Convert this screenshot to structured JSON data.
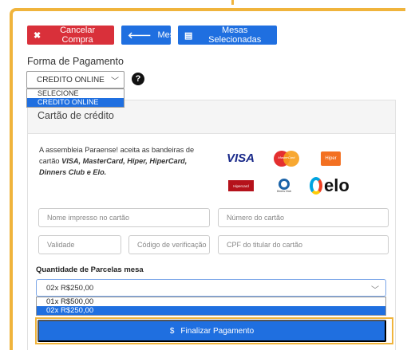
{
  "toolbar": {
    "cancel_label": "Cancelar Compra",
    "mesas_label": "Mesas",
    "selected_label": "Mesas Selecionadas"
  },
  "payment": {
    "label": "Forma de Pagamento",
    "selected": "CREDITO ONLINE",
    "options": [
      "SELECIONE",
      "CREDITO ONLINE"
    ]
  },
  "card": {
    "title": "Cartão de crédito",
    "accept_prefix": "A assembleia Paraense! aceita as bandeiras de cartão ",
    "accept_brands": "VISA, MasterCard, Hiper, HiperCard, Dinners Club e Elo.",
    "brands": {
      "visa": "VISA",
      "mastercard": "MasterCard",
      "hiper": "Hiper",
      "hipercard": "Hipercard",
      "diners": "Diners Club",
      "elo": "elo"
    }
  },
  "fields": {
    "name_placeholder": "Nome impresso no cartão",
    "number_placeholder": "Número do cartão",
    "validity_placeholder": "Validade",
    "cvv_placeholder": "Código de verificação",
    "cpf_placeholder": "CPF do titular do cartão"
  },
  "installments": {
    "label": "Quantidade de Parcelas mesa",
    "selected": "02x R$250,00",
    "options": [
      "01x R$500,00",
      "02x R$250,00"
    ]
  },
  "finish": {
    "label": "Finalizar Pagamento",
    "icon": "$"
  },
  "colors": {
    "accent": "#f0b43c",
    "primary": "#1f6fe0",
    "danger": "#d9303a"
  }
}
